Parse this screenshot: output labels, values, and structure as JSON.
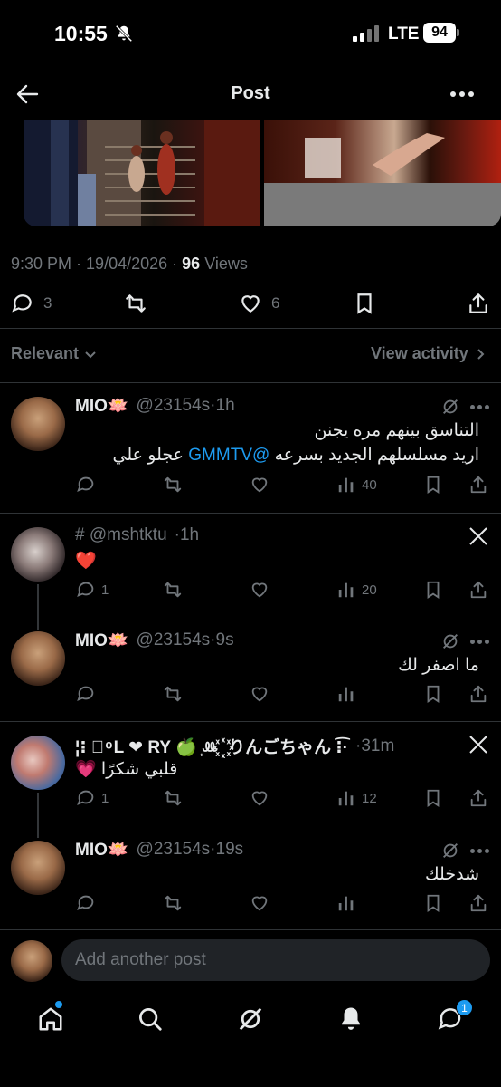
{
  "status_bar": {
    "time": "10:55",
    "network": "LTE",
    "battery": "94"
  },
  "header": {
    "title": "Post"
  },
  "post": {
    "time": "9:30 PM",
    "date": "19/04/2026",
    "views_count": "96",
    "views_label": "Views",
    "replies": "3",
    "likes": "6"
  },
  "filter": {
    "label": "Relevant",
    "activity": "View activity"
  },
  "replies": [
    {
      "name": "MIO🪷",
      "handle": "@23154s",
      "time": "1h",
      "line1": "التناسق بينهم مره يجنن",
      "line2_pre": "اريد مسلسلهم الجديد بسرعه ",
      "mention": "@GMMTV",
      "line2_post": " عجلو علي",
      "views": "40"
    },
    {
      "name": "# @mshtktu",
      "handle": "",
      "time": "1h",
      "text": "❤️",
      "replies": "1",
      "views": "20"
    },
    {
      "name": "MIO🪷",
      "handle": "@23154s",
      "time": "9s",
      "text": "ما اصفر لك"
    },
    {
      "name": "¦⁝ ᷞ ͦ L ❤ RY 🍏 ̟ꔛ ꙰ りんごちゃん ⁝͡·",
      "handle": "",
      "time": "31m",
      "text": "قلبي شكرًا 💗",
      "replies": "1",
      "views": "12"
    },
    {
      "name": "MIO🪷",
      "handle": "@23154s",
      "time": "19s",
      "text": "شدخلك"
    }
  ],
  "composer": {
    "placeholder": "Add another post"
  },
  "nav": {
    "messages_badge": "1"
  },
  "colors": {
    "accent": "#1d9bf0",
    "muted": "#71767b",
    "text": "#e7e9ea",
    "background": "#000000"
  },
  "icons": [
    "back-arrow-icon",
    "more-icon",
    "reply-icon",
    "repost-icon",
    "like-icon",
    "bookmark-icon",
    "share-icon",
    "views-icon",
    "grok-icon",
    "x-logo-icon",
    "home-icon",
    "search-icon",
    "grok-nav-icon",
    "notifications-icon",
    "messages-icon"
  ]
}
